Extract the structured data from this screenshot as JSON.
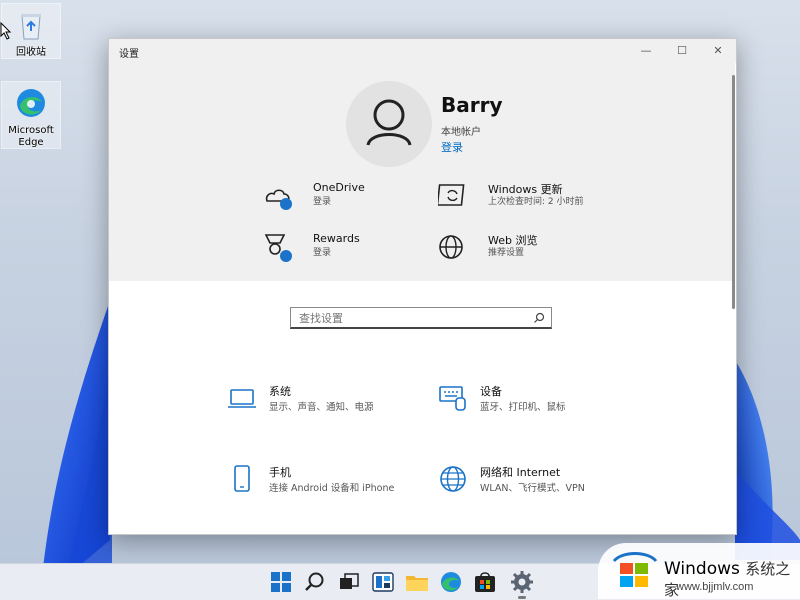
{
  "desktop": {
    "icons": [
      {
        "label": "回收站",
        "icon": "recycle-bin-icon"
      },
      {
        "label": "Microsoft Edge",
        "icon": "edge-icon"
      }
    ]
  },
  "window": {
    "title": "设置",
    "controls": {
      "minimize": "—",
      "maximize": "☐",
      "close": "✕"
    }
  },
  "account": {
    "name": "Barry",
    "type": "本地帐户",
    "action": "登录"
  },
  "quick": [
    {
      "title": "OneDrive",
      "sub": "登录",
      "icon": "onedrive-icon"
    },
    {
      "title": "Windows 更新",
      "sub": "上次检查时间: 2 小时前",
      "icon": "windows-update-icon"
    },
    {
      "title": "Rewards",
      "sub": "登录",
      "icon": "rewards-icon"
    },
    {
      "title": "Web 浏览",
      "sub": "推荐设置",
      "icon": "globe-icon"
    }
  ],
  "search": {
    "placeholder": "查找设置"
  },
  "categories": [
    {
      "title": "系统",
      "sub": "显示、声音、通知、电源",
      "icon": "laptop-icon"
    },
    {
      "title": "设备",
      "sub": "蓝牙、打印机、鼠标",
      "icon": "keyboard-icon"
    },
    {
      "title": "手机",
      "sub": "连接 Android 设备和 iPhone",
      "icon": "phone-icon"
    },
    {
      "title": "网络和 Internet",
      "sub": "WLAN、飞行模式、VPN",
      "icon": "globe-icon"
    }
  ],
  "taskbar": {
    "items": [
      "start-icon",
      "search-icon",
      "task-view-icon",
      "widgets-icon",
      "file-explorer-icon",
      "edge-icon",
      "store-icon",
      "settings-icon"
    ]
  },
  "watermark": {
    "brand": "Windows",
    "brand_cn": "系统之家",
    "url": "www.bjjmlv.com"
  },
  "colors": {
    "accent": "#0067c0",
    "icon_blue": "#1a73c8"
  }
}
